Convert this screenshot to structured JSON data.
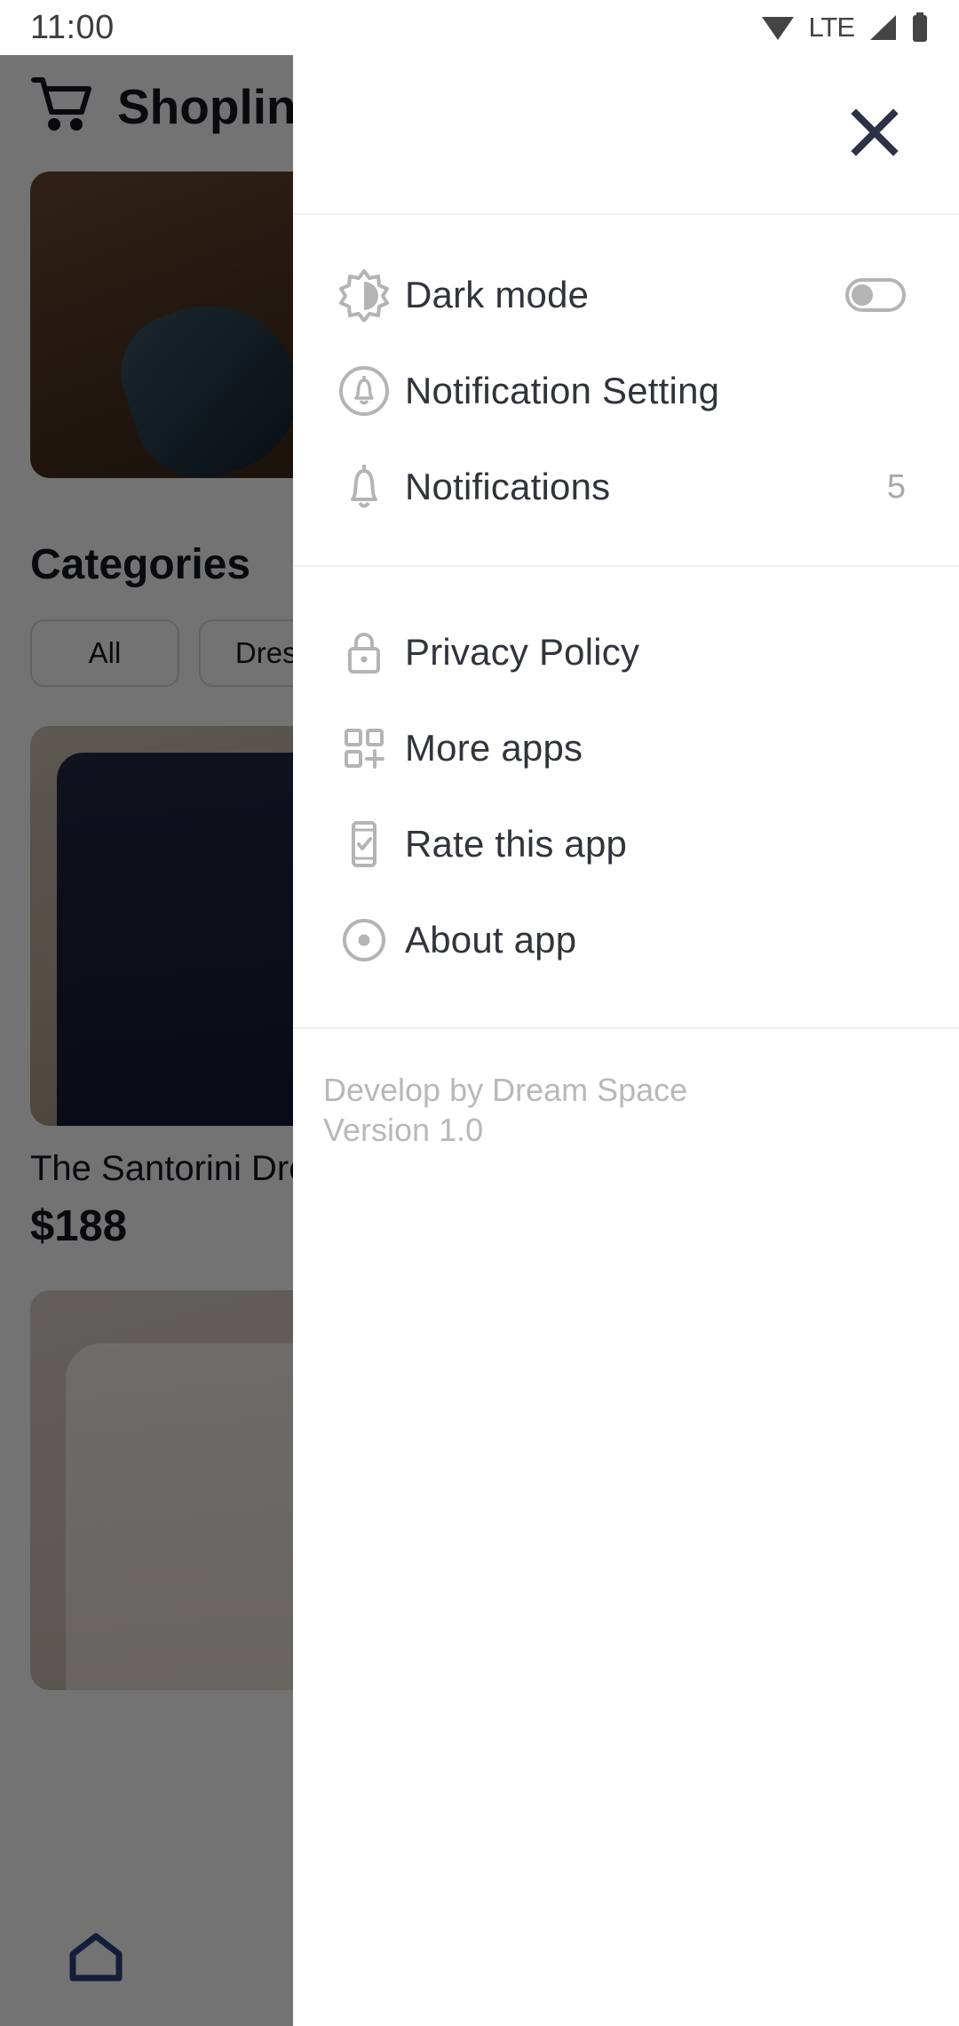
{
  "statusbar": {
    "time": "11:00",
    "network_label": "LTE",
    "icons": [
      "wifi-icon",
      "signal-icon",
      "battery-icon"
    ]
  },
  "background_app": {
    "cart_icon": "shopping-cart-icon",
    "title": "Shopline",
    "section_title": "Categories",
    "chips": [
      {
        "label": "All"
      },
      {
        "label": "Dress"
      }
    ],
    "products": [
      {
        "name": "The Santorini Dress",
        "price": "$188"
      },
      {
        "name": "",
        "price": ""
      }
    ],
    "bottom_nav": [
      {
        "icon": "home-icon",
        "active": true
      }
    ]
  },
  "drawer": {
    "close_icon": "close-icon",
    "groups": [
      {
        "items": [
          {
            "icon": "brightness-icon",
            "label": "Dark mode",
            "control": "toggle",
            "toggle_on": false
          },
          {
            "icon": "notification-setting-icon",
            "label": "Notification Setting",
            "control": "none"
          },
          {
            "icon": "bell-icon",
            "label": "Notifications",
            "control": "count",
            "count": "5"
          }
        ]
      },
      {
        "items": [
          {
            "icon": "lock-icon",
            "label": "Privacy Policy",
            "control": "none"
          },
          {
            "icon": "grid-plus-icon",
            "label": "More apps",
            "control": "none"
          },
          {
            "icon": "phone-check-icon",
            "label": "Rate this app",
            "control": "none"
          },
          {
            "icon": "info-circle-icon",
            "label": "About app",
            "control": "none"
          }
        ]
      }
    ],
    "footer": {
      "developer": "Develop by Dream Space",
      "version": "Version 1.0"
    }
  },
  "colors": {
    "close_icon": "#2e3045",
    "label_text": "#31343c",
    "muted_text": "#b8b8b8",
    "icon_gray": "#b4b4b4",
    "accent_blue": "#2d4380",
    "panel_bg": "#ffffff",
    "divider": "#f0f0f0"
  }
}
